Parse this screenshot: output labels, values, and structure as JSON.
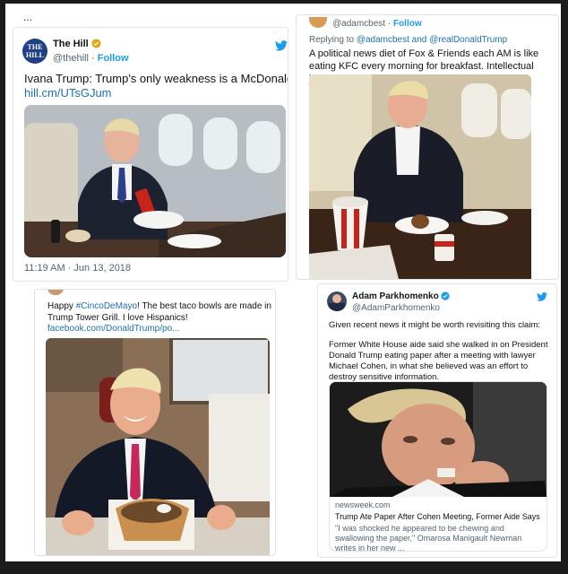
{
  "page": {
    "ellipsis": "..."
  },
  "tweet1": {
    "account_name": "The Hill",
    "handle": "@thehill",
    "follow_label": "Follow",
    "avatar_text_top": "THE",
    "avatar_text_bottom": "HILL",
    "text": "Ivana Trump: Trump's only weakness is a McDonald's Big Mac",
    "link": "hill.cm/UTsGJum",
    "timestamp": "11:19 AM · Jun 13, 2018"
  },
  "tweet2": {
    "handle": "@adamcbest",
    "follow_label": "Follow",
    "reply_prefix": "Replying to",
    "reply_handles": "@adamcbest and @realDonaldTrump",
    "text": "A political news diet of Fox & Friends each AM is like eating KFC every morning for breakfast. Intellectual junk food."
  },
  "tweet3": {
    "text_start": "Happy ",
    "hashtag": "#CincoDeMayo",
    "text_rest": "! The best taco bowls are made in Trump Tower Grill. I love Hispanics!",
    "link": "facebook.com/DonaldTrump/po..."
  },
  "tweet4": {
    "account_name": "Adam Parkhomenko",
    "handle": "@AdamParkhomenko",
    "text1": "Given recent news it might be worth revisiting this claim:",
    "text2": "Former White House aide said she walked in on President Donald Trump eating paper after a meeting with lawyer Michael Cohen, in what she believed was an effort to destroy sensitive information.",
    "card_domain": "newsweek.com",
    "card_title": "Trump Ate Paper After Cohen Meeting, Former Aide Says",
    "card_desc": "\"I was shocked he appeared to be chewing and swallowing the paper,\" Omarosa Manigault Newman writes in her new ..."
  },
  "colors": {
    "accent": "#1d9bf0",
    "link": "#1b6fb5",
    "muted": "#536471",
    "text": "#0f1419",
    "frame": "#1b1b1b"
  }
}
